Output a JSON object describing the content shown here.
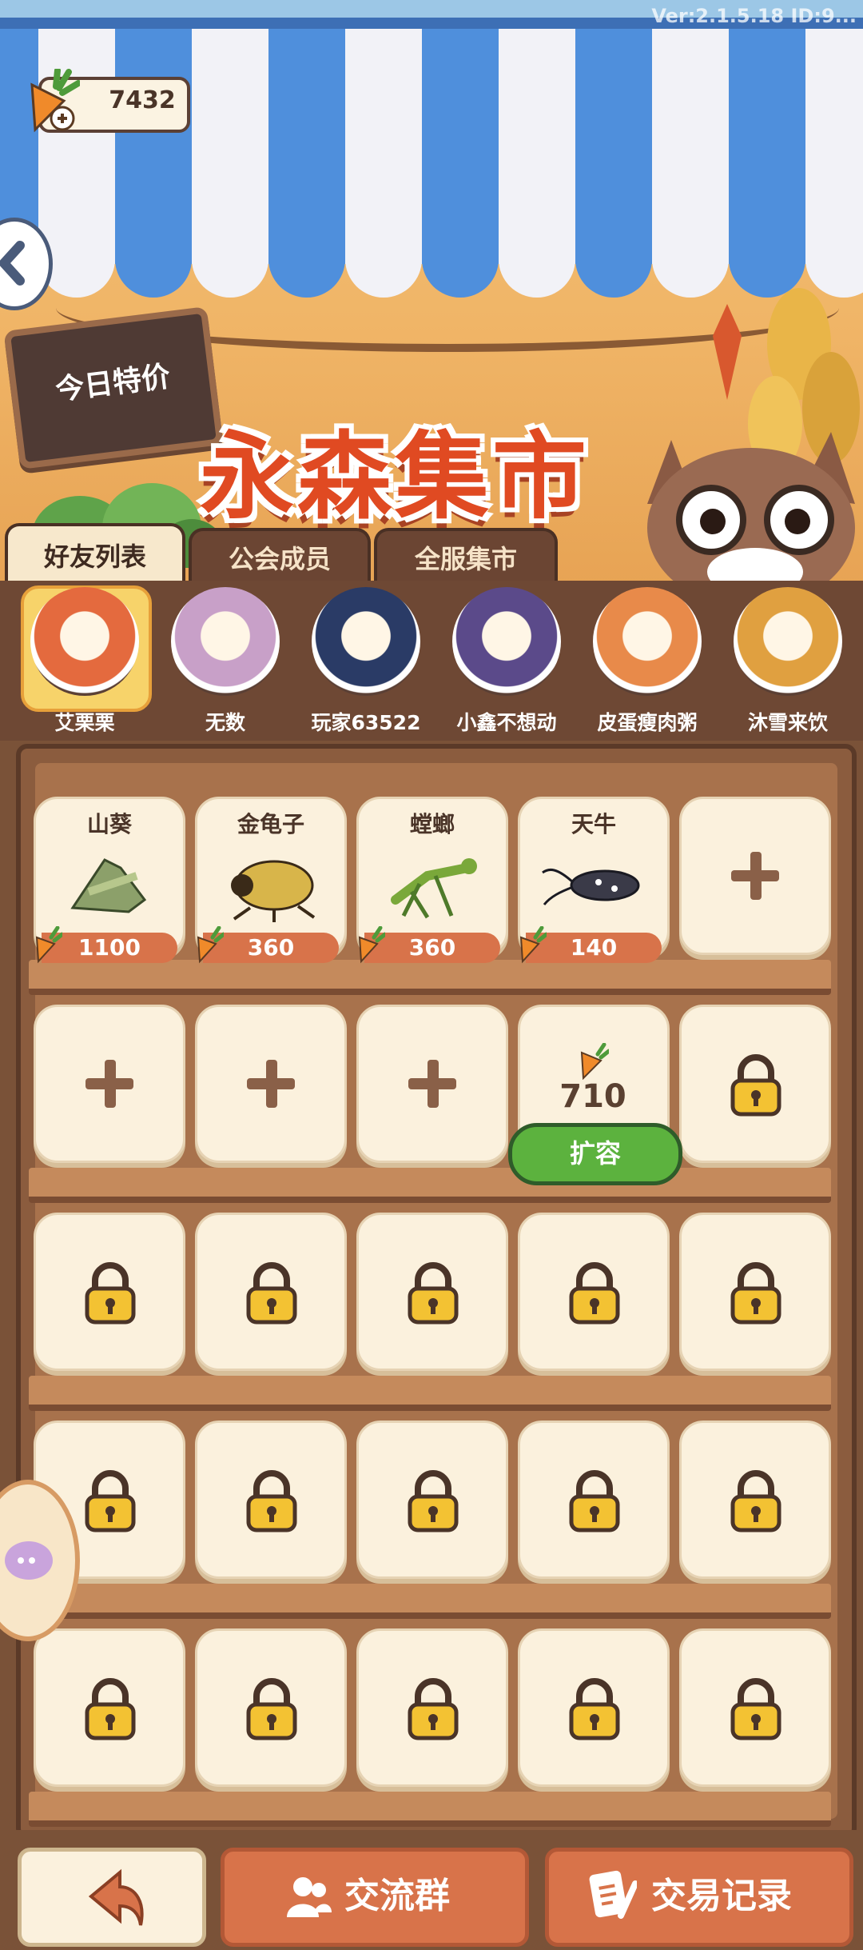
{
  "hud": {
    "version_text": "Ver:2.1.5.18 ID:9...",
    "carrot_count": "7432"
  },
  "banner": {
    "sign_text": "今日特价",
    "title": "永森集市"
  },
  "tabs": [
    {
      "label": "好友列表",
      "active": true
    },
    {
      "label": "公会成员",
      "active": false
    },
    {
      "label": "全服集市",
      "active": false
    }
  ],
  "friends": [
    {
      "name": "艾栗栗",
      "selected": true,
      "color": "#e46a3e"
    },
    {
      "name": "无数",
      "selected": false,
      "color": "#c8a0c8"
    },
    {
      "name": "玩家63522",
      "selected": false,
      "color": "#2a3b66"
    },
    {
      "name": "小鑫不想动",
      "selected": false,
      "color": "#5b4a8a"
    },
    {
      "name": "皮蛋瘦肉粥",
      "selected": false,
      "color": "#e88a4a"
    },
    {
      "name": "沐雪来饮",
      "selected": false,
      "color": "#e0a040"
    }
  ],
  "listings": [
    {
      "name": "山葵",
      "price": "1100"
    },
    {
      "name": "金龟子",
      "price": "360"
    },
    {
      "name": "螳螂",
      "price": "360"
    },
    {
      "name": "天牛",
      "price": "140"
    }
  ],
  "expand": {
    "cost": "710",
    "label": "扩容"
  },
  "bottom": {
    "group_label": "交流群",
    "records_label": "交易记录"
  },
  "colors": {
    "accent": "#d8734a",
    "expand_green": "#5cb23e",
    "awning_blue": "#4f8fdc"
  }
}
